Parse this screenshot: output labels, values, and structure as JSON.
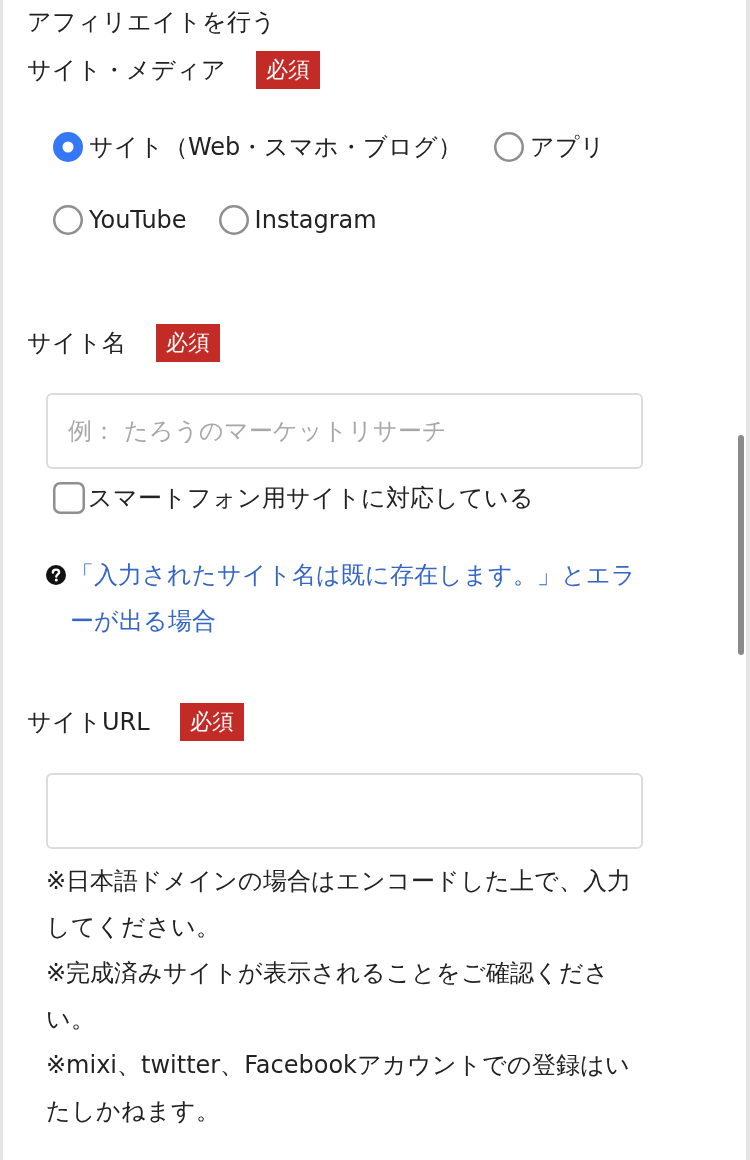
{
  "heading": "アフィリエイトを行う",
  "sections": [
    {
      "kind": "radio",
      "label": "サイト・メディア",
      "badge": "必須",
      "options": [
        {
          "label": "サイト（Web・スマホ・ブログ）",
          "selected": true
        },
        {
          "label": "アプリ",
          "selected": false
        },
        {
          "label": "YouTube",
          "selected": false
        },
        {
          "label": "Instagram",
          "selected": false
        }
      ]
    },
    {
      "kind": "text",
      "label": "サイト名",
      "badge": "必須",
      "placeholder": "例： たろうのマーケットリサーチ",
      "checkbox": {
        "label": "スマートフォン用サイトに対応している",
        "checked": false
      },
      "help_link": "「入力されたサイト名は既に存在します。」とエラーが出る場合"
    },
    {
      "kind": "text",
      "label": "サイトURL",
      "badge": "必須",
      "notes": [
        "※日本語ドメインの場合はエンコードした上で、入力してください。",
        "※完成済みサイトが表示されることをご確認ください。",
        "※mixi、twitter、Facebookアカウントでの登録はいたしかねます。"
      ]
    }
  ]
}
